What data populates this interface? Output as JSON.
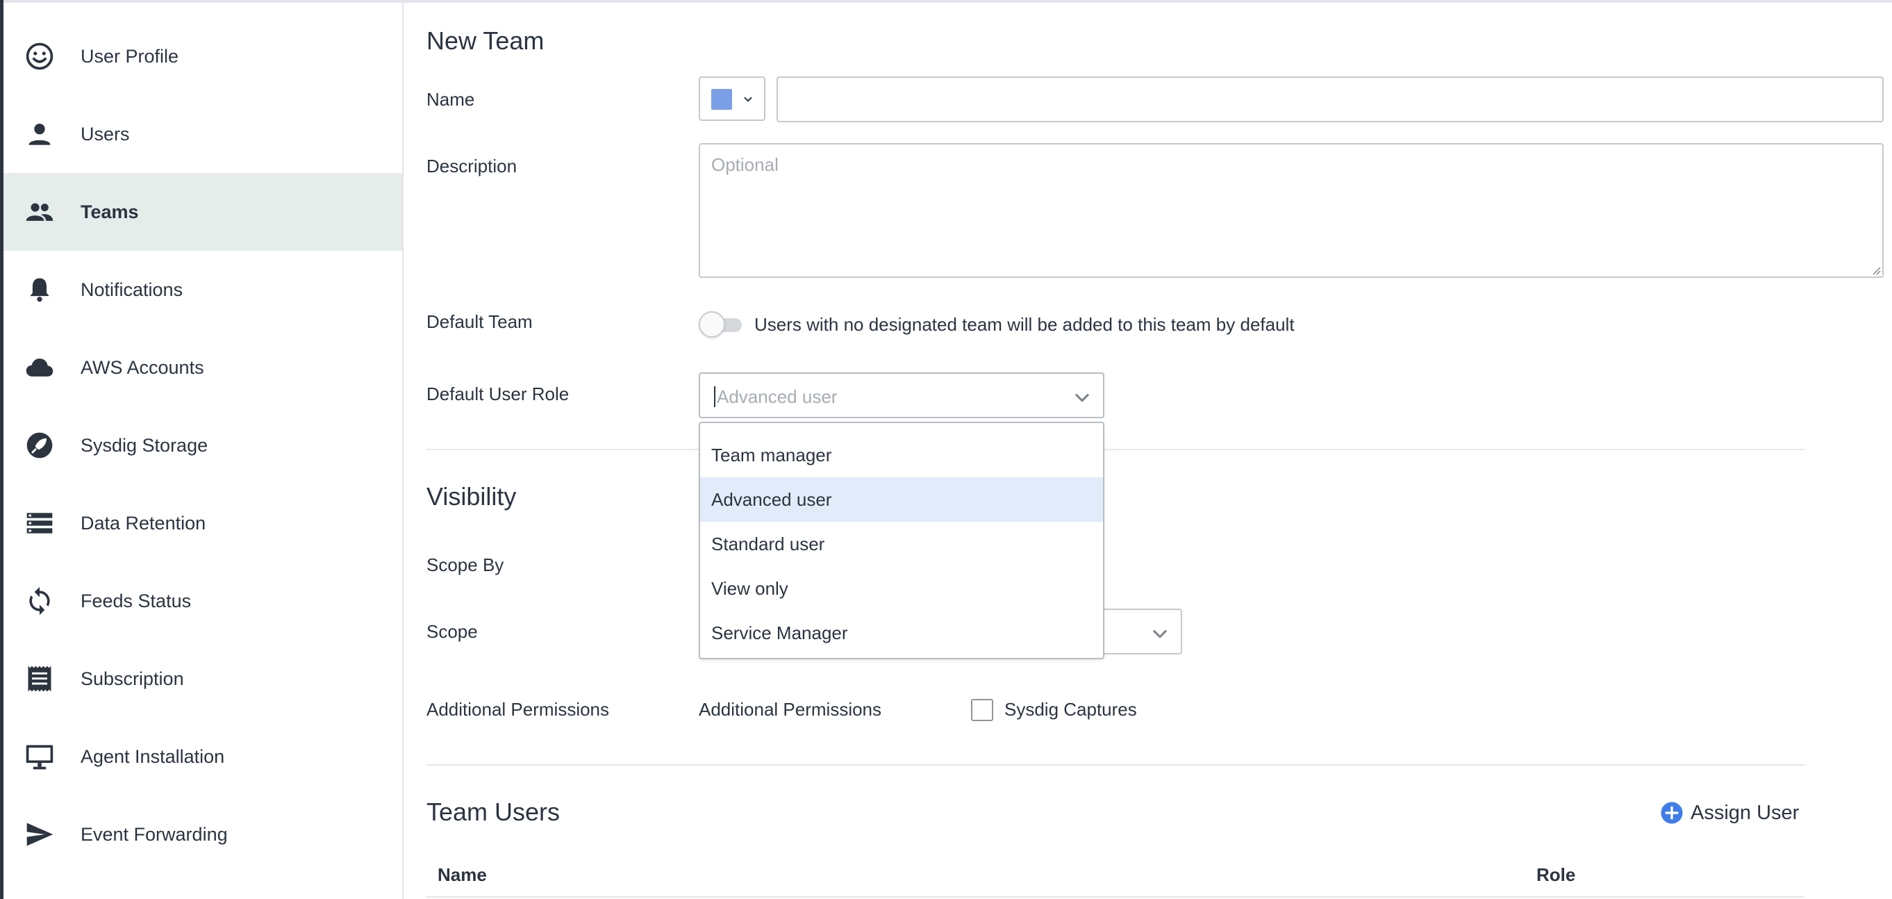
{
  "sidebar": {
    "items": [
      {
        "label": "User Profile",
        "icon": "smiley-face-icon",
        "active": false
      },
      {
        "label": "Users",
        "icon": "person-icon",
        "active": false
      },
      {
        "label": "Teams",
        "icon": "people-icon",
        "active": true
      },
      {
        "label": "Notifications",
        "icon": "bell-icon",
        "active": false
      },
      {
        "label": "AWS Accounts",
        "icon": "cloud-icon",
        "active": false
      },
      {
        "label": "Sysdig Storage",
        "icon": "rocket-icon",
        "active": false
      },
      {
        "label": "Data Retention",
        "icon": "storage-list-icon",
        "active": false
      },
      {
        "label": "Feeds Status",
        "icon": "sync-icon",
        "active": false
      },
      {
        "label": "Subscription",
        "icon": "receipt-icon",
        "active": false
      },
      {
        "label": "Agent Installation",
        "icon": "monitor-icon",
        "active": false
      },
      {
        "label": "Event Forwarding",
        "icon": "send-icon",
        "active": false
      }
    ]
  },
  "form": {
    "title": "New Team",
    "name_label": "Name",
    "name_value": "",
    "team_color": "#7b9fe7",
    "description_label": "Description",
    "description_placeholder": "Optional",
    "default_team_label": "Default Team",
    "default_team_toggle_text": "Users with no designated team will be added to this team by default",
    "default_team_enabled": false,
    "default_role_label": "Default User Role",
    "default_role_placeholder": "Advanced user",
    "role_options": [
      "Team manager",
      "Advanced user",
      "Standard user",
      "View only",
      "Service Manager"
    ],
    "highlighted_option": "Advanced user"
  },
  "visibility": {
    "title": "Visibility",
    "scope_by_label": "Scope By",
    "scope_label": "Scope",
    "additional_permissions_label": "Additional Permissions",
    "additional_permissions_sublabel": "Additional Permissions",
    "sysdig_captures_label": "Sysdig Captures",
    "sysdig_captures_checked": false
  },
  "team_users": {
    "title": "Team Users",
    "assign_user_label": "Assign User",
    "columns": [
      "Name",
      "Role"
    ]
  },
  "colors": {
    "accent": "#3f7ee8",
    "active_bg": "#e5ecea",
    "highlight_bg": "#e2ebf9",
    "text": "#2b3441"
  }
}
